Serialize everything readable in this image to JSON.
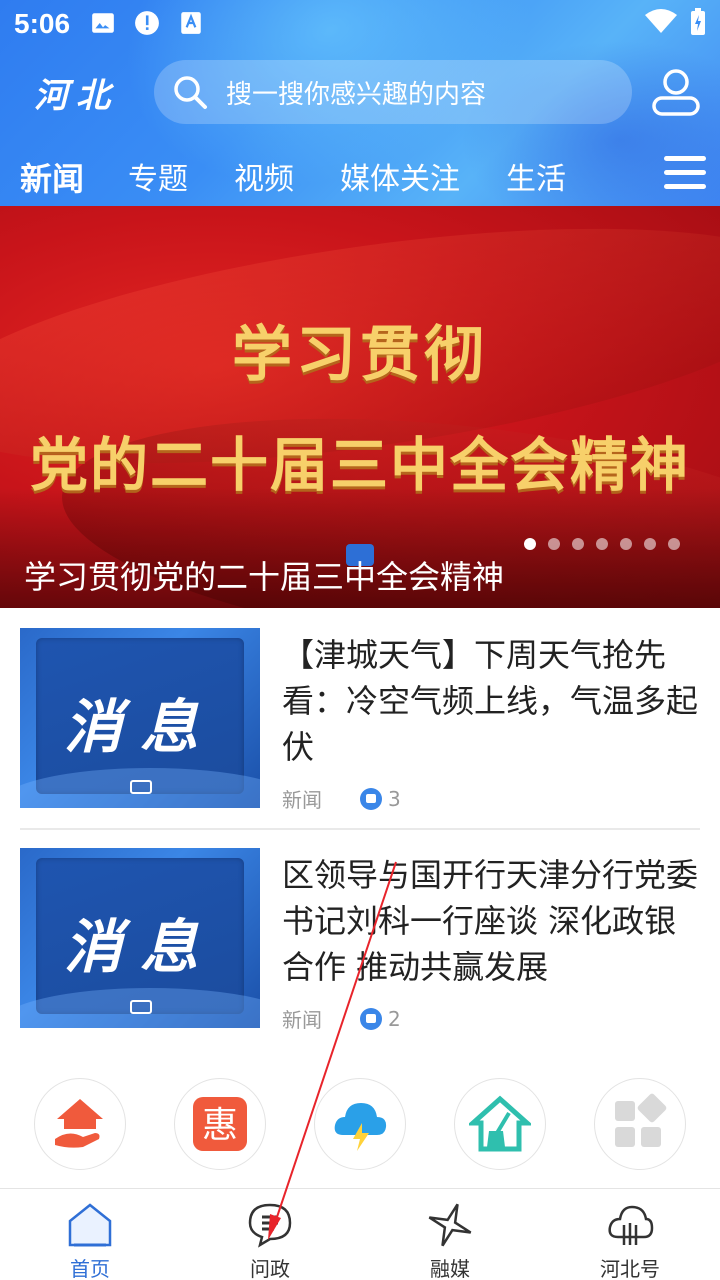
{
  "status": {
    "time": "5:06"
  },
  "header": {
    "logo": "河北",
    "search_placeholder": "搜一搜你感兴趣的内容",
    "tabs": [
      "新闻",
      "专题",
      "视频",
      "媒体关注",
      "生活"
    ]
  },
  "banner": {
    "line1": "学习贯彻",
    "line2": "党的二十届三中全会精神",
    "caption": "学习贯彻党的二十届三中全会精神",
    "dot_count": 7,
    "active_dot": 0
  },
  "news": [
    {
      "thumb_text": "消息",
      "title": "【津城天气】下周天气抢先看：冷空气频上线，气温多起伏",
      "category": "新闻",
      "likes": "3"
    },
    {
      "thumb_text": "消息",
      "title": "区领导与国开行天津分行党委书记刘科一行座谈 深化政银合作 推动共赢发展",
      "category": "新闻",
      "likes": "2"
    }
  ],
  "quick_icons": [
    "house-hand-icon",
    "hui-icon",
    "weather-icon",
    "home-clean-icon",
    "more-apps-icon"
  ],
  "quick_hui_text": "惠",
  "bottom_nav": [
    {
      "label": "首页",
      "icon": "home-icon",
      "active": true
    },
    {
      "label": "问政",
      "icon": "chat-icon",
      "active": false
    },
    {
      "label": "融媒",
      "icon": "star-icon",
      "active": false
    },
    {
      "label": "河北号",
      "icon": "cloud-icon",
      "active": false
    }
  ],
  "colors": {
    "brand_blue": "#3a8ef5",
    "banner_red": "#c8141a",
    "banner_gold": "#f7d06a",
    "active_nav": "#2f6fd6"
  }
}
